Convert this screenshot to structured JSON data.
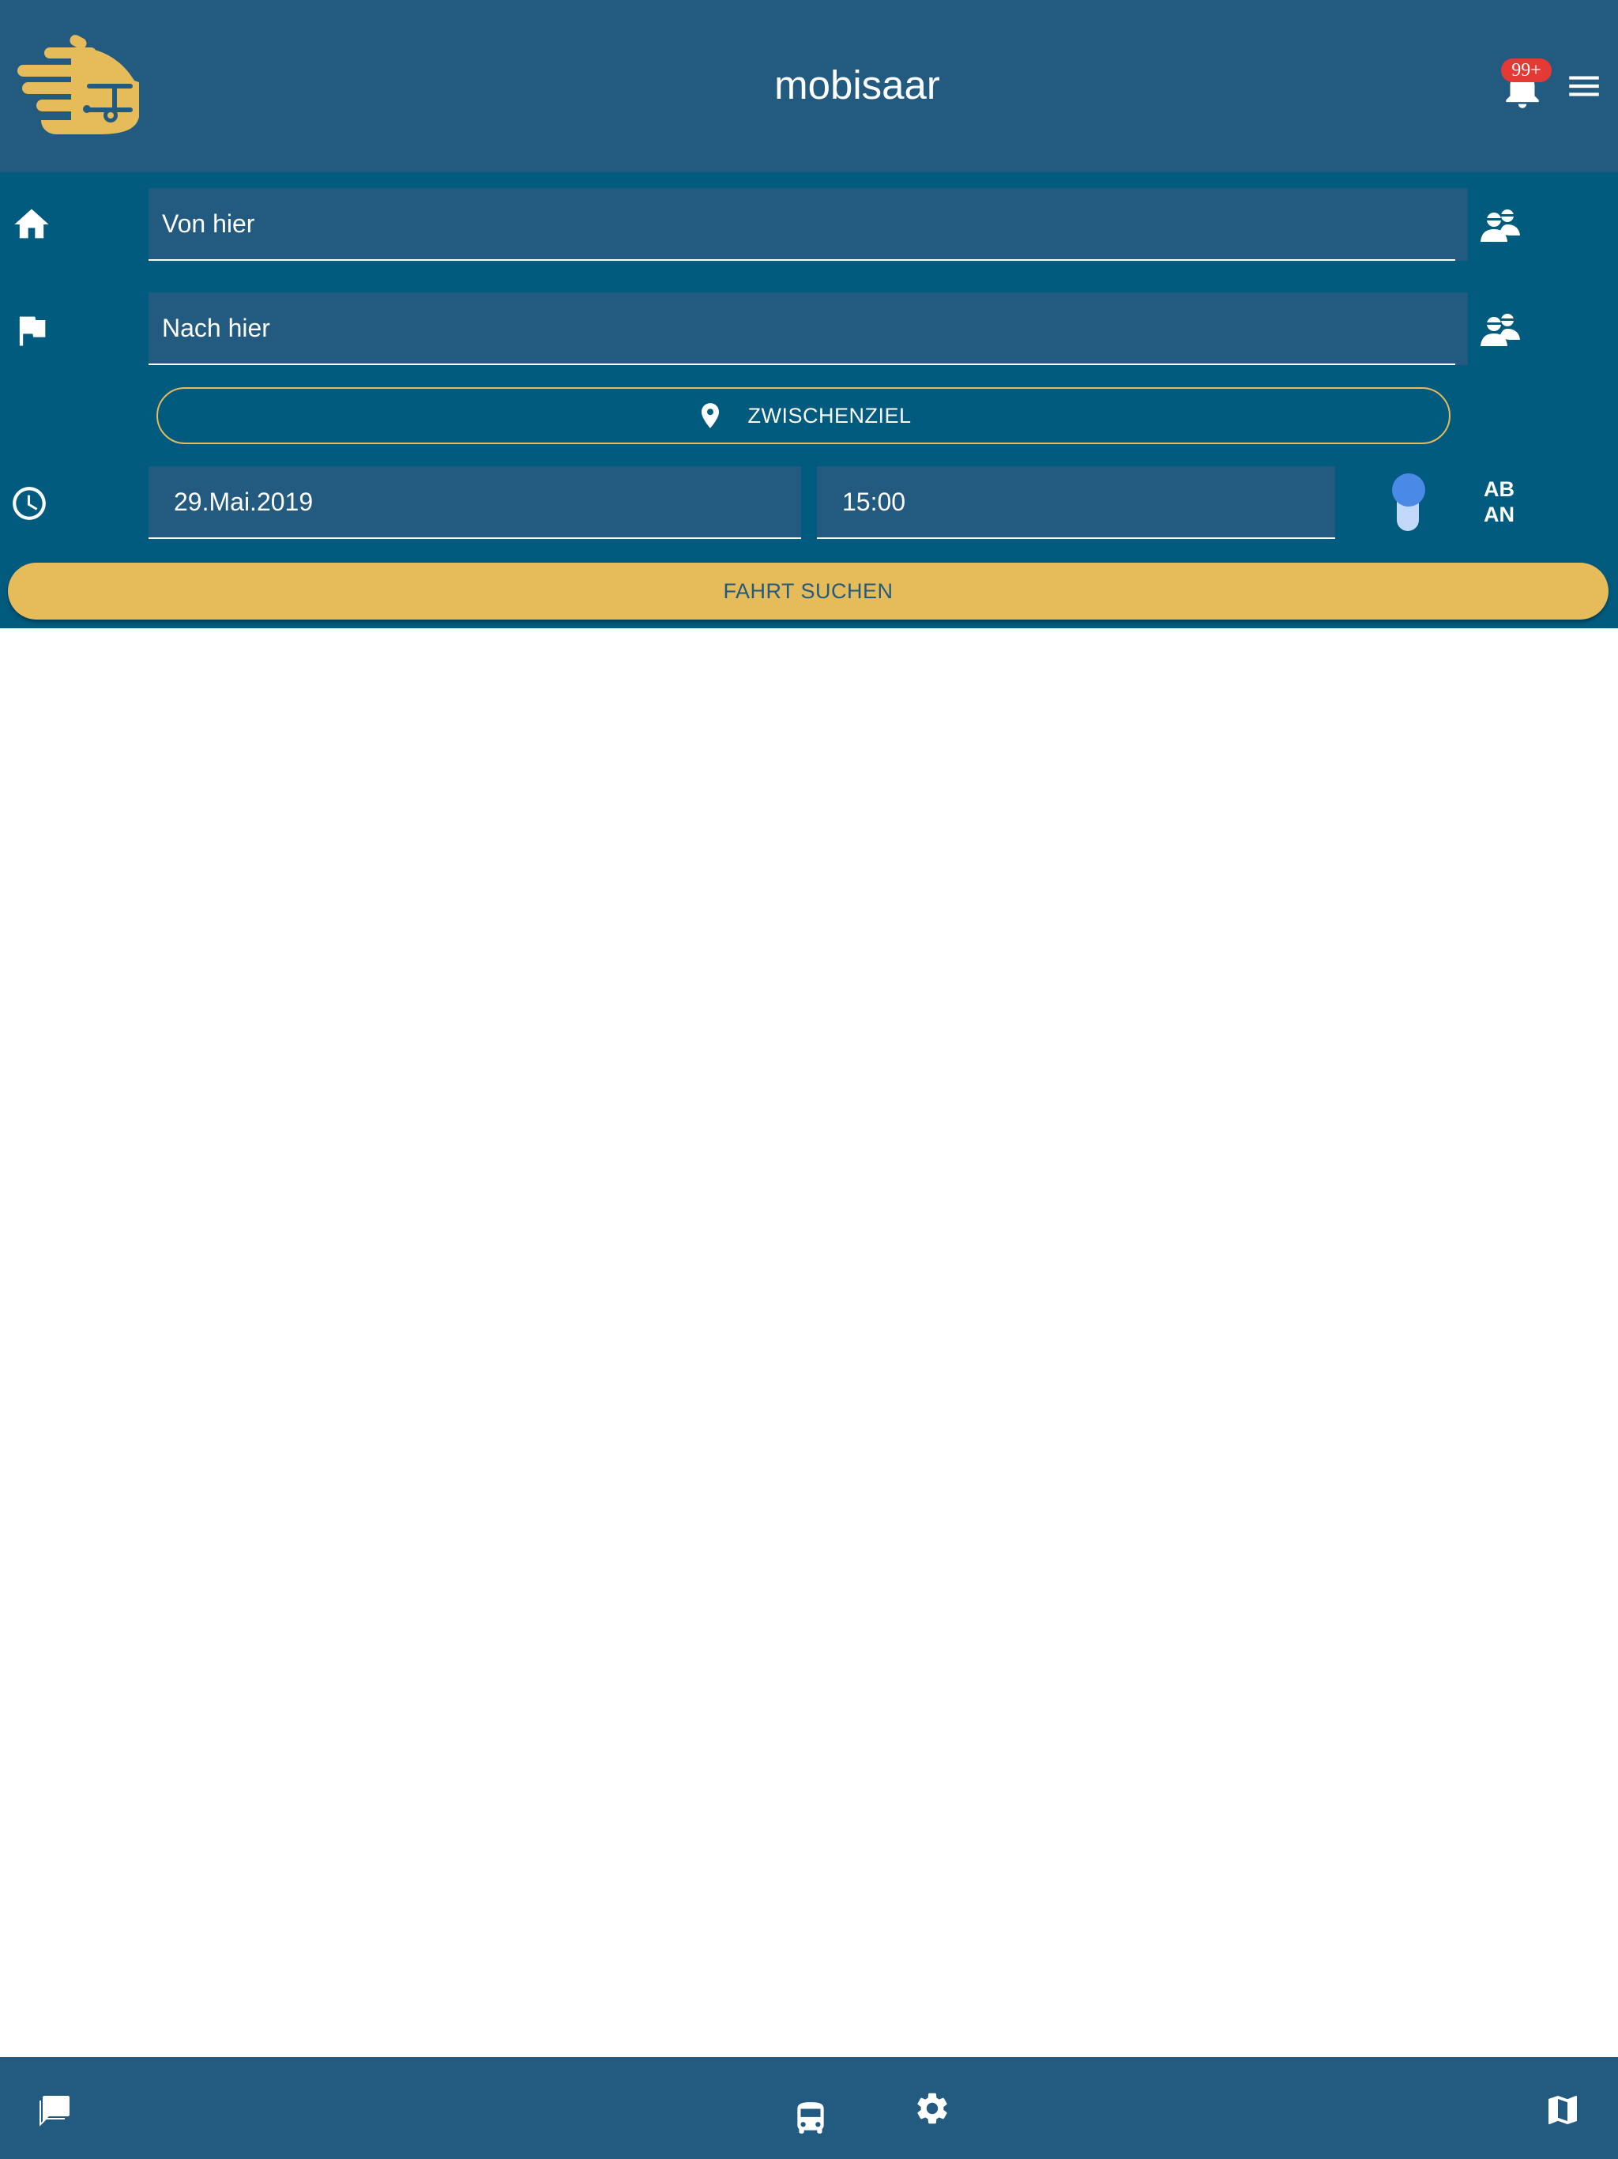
{
  "header": {
    "title": "mobisaar",
    "notification_count": "99+"
  },
  "search": {
    "from_placeholder": "Von hier",
    "to_placeholder": "Nach hier",
    "via_label": "ZWISCHENZIEL",
    "date": "29.Mai.2019",
    "time": "15:00",
    "toggle_options": [
      "AB",
      "AN"
    ],
    "toggle_selected": "AB",
    "submit_label": "FAHRT SUCHEN"
  },
  "bottom_nav": [
    "chat-icon",
    "bus-icon",
    "settings-icon",
    "map-icon"
  ],
  "colors": {
    "primary": "#235b80",
    "search_panel": "#005b7f",
    "accent": "#e6bb5a",
    "badge": "#e53935",
    "toggle": "#4a89e6"
  }
}
